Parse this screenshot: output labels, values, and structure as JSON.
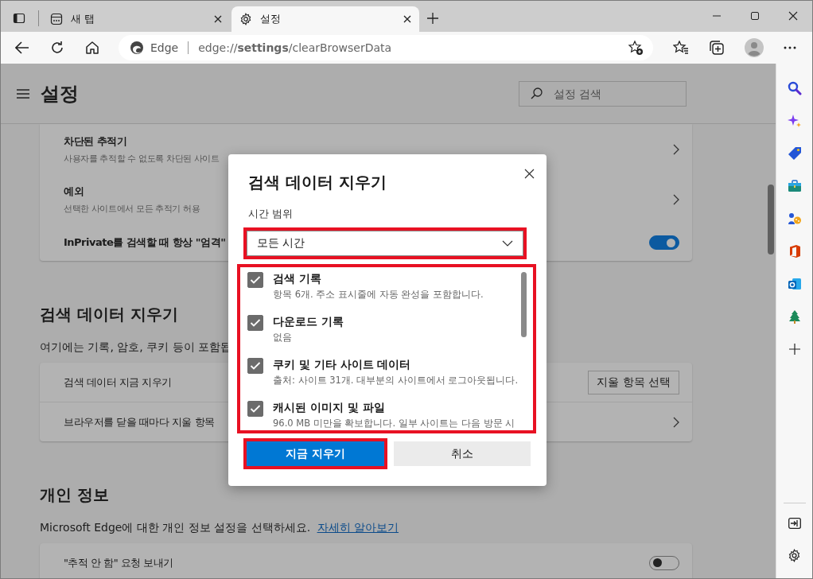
{
  "tabs": [
    {
      "label": "새 탭",
      "selected": false
    },
    {
      "label": "설정",
      "selected": true
    }
  ],
  "address_bar": {
    "site_label": "Edge",
    "url": "edge://**settings**/clearBrowserData"
  },
  "page": {
    "title": "설정",
    "search": {
      "placeholder": "설정 검색"
    }
  },
  "sections": [
    {
      "rows": [
        {
          "kind": "link",
          "title": "차단된 추적기",
          "description": "사용자를 추적할 수 없도록 차단된 사이트"
        },
        {
          "kind": "link",
          "title": "예외",
          "description": "선택한 사이트에서 모든 추적기 허용"
        },
        {
          "kind": "toggle",
          "title": "InPrivate를 검색할 때 항상 \"엄격\"",
          "on": true
        }
      ]
    },
    {
      "heading": "검색 데이터 지우기",
      "description": "여기에는 기록, 암호, 쿠키 등이 포함됩",
      "rows": [
        {
          "kind": "button",
          "title": "검색 데이터 지금 지우기",
          "button": "지울 항목 선택"
        },
        {
          "kind": "link",
          "title": "브라우저를 닫을 때마다 지울 항목"
        }
      ]
    },
    {
      "heading": "개인 정보",
      "description": "Microsoft Edge에 대한 개인 정보 설정을 선택하세요.",
      "link": "자세히 알아보기",
      "rows": [
        {
          "kind": "toggle",
          "title": "\"추적 안 함\" 요청 보내기",
          "on": false
        }
      ]
    }
  ],
  "dialog": {
    "title": "검색 데이터 지우기",
    "time_range": {
      "label": "시간 범위",
      "value": "모든 시간",
      "highlighted": true
    },
    "items_highlighted": true,
    "items": [
      {
        "label": "검색 기록",
        "description": "항목 6개. 주소 표시줄에 자동 완성을 포함합니다.",
        "checked": true
      },
      {
        "label": "다운로드 기록",
        "description": "없음",
        "checked": true
      },
      {
        "label": "쿠키 및 기타 사이트 데이터",
        "description": "출처: 사이트 31개. 대부분의 사이트에서 로그아웃됩니다.",
        "checked": true
      },
      {
        "label": "캐시된 이미지 및 파일",
        "description": "96.0 MB 미만을 확보합니다. 일부 사이트는 다음 방문 시",
        "checked": true
      }
    ],
    "buttons": [
      {
        "kind": "primary",
        "label": "지금 지우기",
        "highlighted": true
      },
      {
        "kind": "secondary",
        "label": "취소",
        "highlighted": false
      }
    ]
  }
}
